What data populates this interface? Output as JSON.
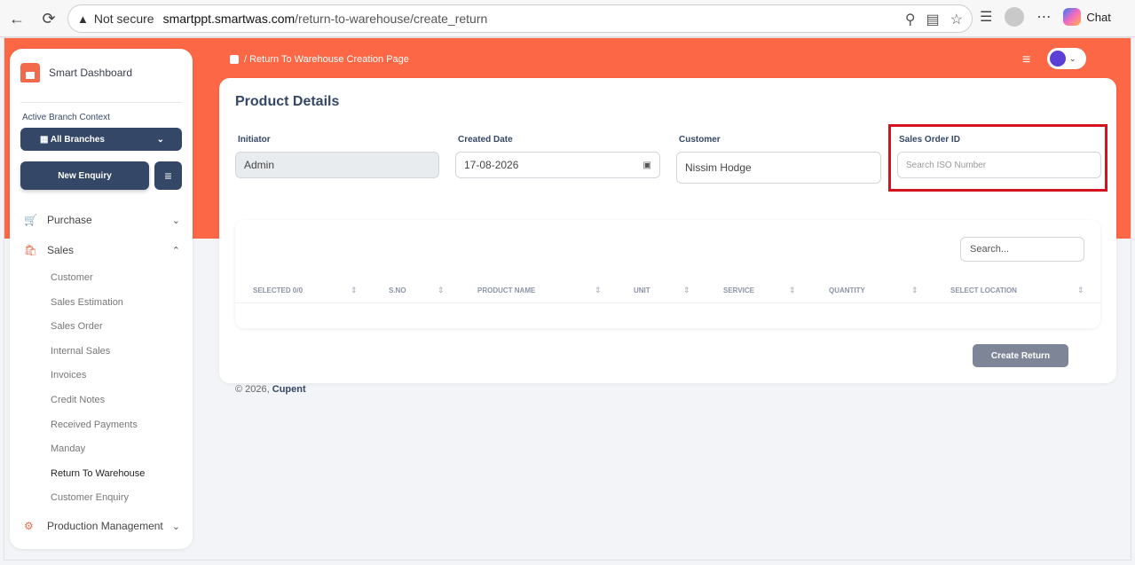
{
  "browser": {
    "not_secure": "Not secure",
    "url_host": "smartppt.smartwas.com",
    "url_path": "/return-to-warehouse/create_return",
    "chat_label": "Chat"
  },
  "sidebar": {
    "brand": "Smart Dashboard",
    "context_label": "Active Branch Context",
    "branch_value": "All Branches",
    "new_enquiry": "New Enquiry",
    "items": [
      {
        "label": "Purchase",
        "icon": "cart-icon"
      },
      {
        "label": "Sales",
        "icon": "bag-icon"
      },
      {
        "label": "Production Management",
        "icon": "factory-icon"
      }
    ],
    "sales_sub": [
      "Customer",
      "Sales Estimation",
      "Sales Order",
      "Internal Sales",
      "Invoices",
      "Credit Notes",
      "Received Payments",
      "Manday",
      "Return To Warehouse",
      "Customer Enquiry"
    ],
    "active_sub": "Return To Warehouse"
  },
  "header": {
    "breadcrumb": "/ Return To Warehouse Creation Page"
  },
  "form": {
    "title": "Product Details",
    "initiator_label": "Initiator",
    "initiator_value": "Admin",
    "created_date_label": "Created Date",
    "created_date_value": "17-08-2026",
    "customer_label": "Customer",
    "customer_value": "Nissim Hodge",
    "sales_order_label": "Sales Order ID",
    "sales_order_placeholder": "Search ISO Number"
  },
  "table": {
    "search_placeholder": "Search...",
    "columns": [
      "SELECTED 0/0",
      "S.NO",
      "PRODUCT NAME",
      "UNIT",
      "SERVICE",
      "QUANTITY",
      "SELECT LOCATION"
    ]
  },
  "actions": {
    "create_return": "Create Return"
  },
  "footer": {
    "copyright": "© 2026,",
    "company": "Cupent"
  },
  "colors": {
    "accent": "#fc6745",
    "primary": "#344767",
    "highlight": "#d4121e"
  }
}
